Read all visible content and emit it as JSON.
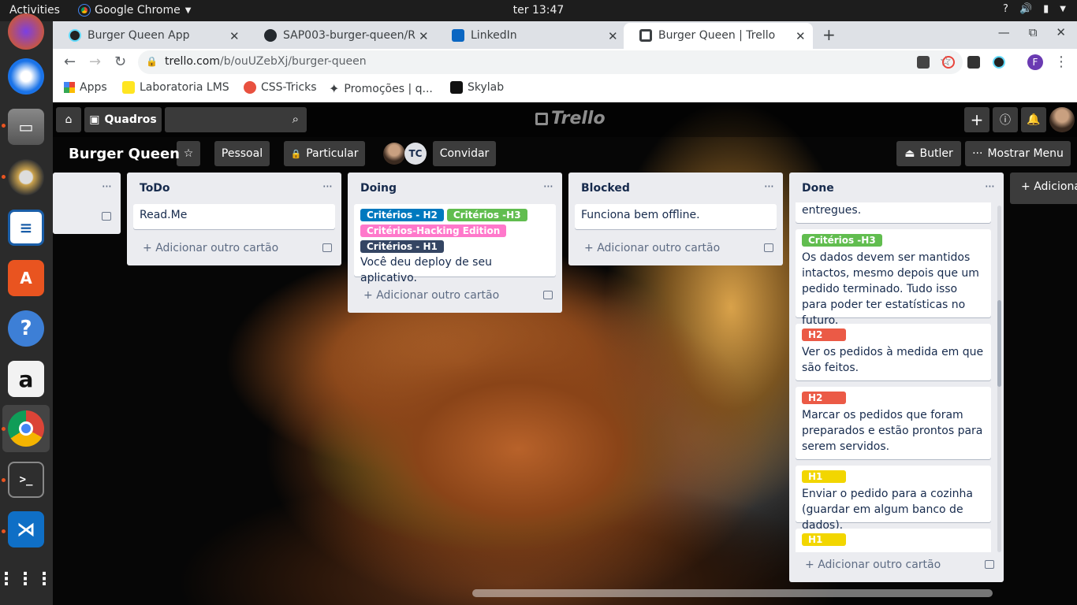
{
  "ubuntu": {
    "activities": "Activities",
    "app_name": "Google Chrome",
    "clock": "ter 13:47",
    "help": "?"
  },
  "tabs": [
    {
      "title": "Burger Queen App"
    },
    {
      "title": "SAP003-burger-queen/RE"
    },
    {
      "title": "LinkedIn"
    },
    {
      "title": "Burger Queen | Trello"
    }
  ],
  "address": {
    "host": "trello.com",
    "path": "/b/ouUZebXj/burger-queen"
  },
  "profile_initial": "F",
  "bookmarks": [
    {
      "label": "Apps"
    },
    {
      "label": "Laboratoria LMS"
    },
    {
      "label": "CSS-Tricks"
    },
    {
      "label": "Promoções | q..."
    },
    {
      "label": "Skylab"
    }
  ],
  "trello": {
    "boards_label": "Quadros",
    "logo": "Trello",
    "board_title": "Burger Queen",
    "team_label": "Pessoal",
    "visibility_label": "Particular",
    "member_initials": "TC",
    "invite_label": "Convidar",
    "butler_label": "Butler",
    "menu_label": "Mostrar Menu",
    "add_list_label": "Adiciona",
    "add_card_label": "Adicionar outro cartão"
  },
  "lists": {
    "todo": {
      "title": "ToDo",
      "cards": [
        "Read.Me"
      ]
    },
    "doing": {
      "title": "Doing",
      "labels": [
        "Critérios - H2",
        "Critérios -H3",
        "Critérios-Hacking Edition",
        "Critérios - H1"
      ],
      "card": "Você deu deploy de seu aplicativo."
    },
    "blocked": {
      "title": "Blocked",
      "cards": [
        "Funciona bem offline."
      ]
    },
    "done": {
      "title": "Done",
      "cards": [
        {
          "label": "",
          "text": "entregues."
        },
        {
          "label": "Critérios -H3",
          "text": "Os dados devem ser mantidos intactos, mesmo depois que um pedido terminado. Tudo isso para poder ter estatísticas no futuro."
        },
        {
          "label": "H2",
          "text": "Ver os pedidos à medida em que são feitos."
        },
        {
          "label": "H2",
          "text": "Marcar os pedidos que foram preparados e estão prontos para serem servidos."
        },
        {
          "label": "H1",
          "text": "Enviar o pedido para a cozinha (guardar em algum banco de dados)."
        },
        {
          "label": "H1",
          "text": ""
        }
      ]
    }
  },
  "colors": {
    "green": "#61bd4f",
    "blue": "#0079bf",
    "pink": "#ff78cb",
    "dark": "#344563",
    "red": "#eb5a46",
    "yellow": "#f2d600"
  }
}
